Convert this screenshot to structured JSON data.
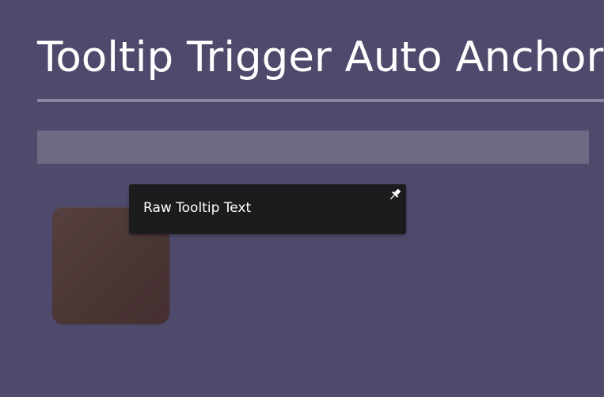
{
  "page": {
    "title": "Tooltip Trigger Auto Anchor"
  },
  "tooltip": {
    "text": "Raw Tooltip Text",
    "pin_icon": "pin-icon"
  },
  "colors": {
    "background": "#4f4a6b",
    "header_bar": "#6e6a84",
    "title_rule": "#8a87a0",
    "trigger": "#4a3535",
    "tooltip_bg": "#1c1c1e",
    "text": "#ffffff"
  }
}
